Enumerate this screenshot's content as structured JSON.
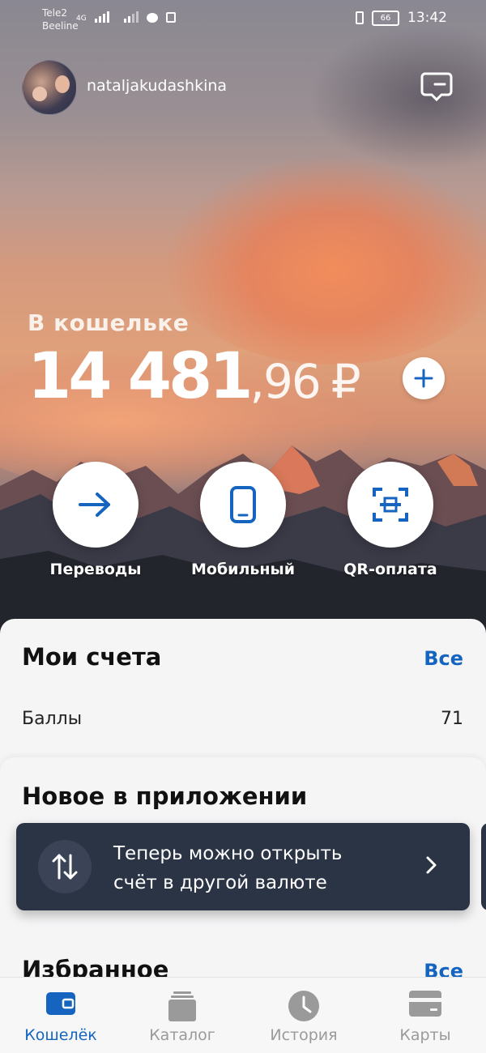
{
  "status_bar": {
    "carrier1": "Tele2",
    "carrier2": "Beeline",
    "network": "4G",
    "battery": "66",
    "time": "13:42"
  },
  "header": {
    "username": "nataljakudashkina",
    "avatar_icon": "avatar",
    "support_icon": "chat-bubble-icon"
  },
  "wallet": {
    "label": "В кошельке",
    "balance_int": "14 481",
    "balance_frac": ",96",
    "currency": "₽",
    "add_icon": "plus-icon"
  },
  "actions": [
    {
      "label": "Переводы",
      "icon": "arrow-right-icon"
    },
    {
      "label": "Мобильный",
      "icon": "phone-icon"
    },
    {
      "label": "QR-оплата",
      "icon": "qr-scan-icon"
    }
  ],
  "accounts": {
    "title": "Мои счета",
    "all_link": "Все",
    "rows": [
      {
        "label": "Баллы",
        "value": "71"
      }
    ]
  },
  "news": {
    "title": "Новое в приложении",
    "promo_line1": "Теперь можно открыть",
    "promo_line2": "счёт в другой валюте"
  },
  "favorites": {
    "title": "Избранное",
    "all_link": "Все"
  },
  "tabs": [
    {
      "label": "Кошелёк",
      "icon": "wallet-icon",
      "active": true
    },
    {
      "label": "Каталог",
      "icon": "catalog-icon",
      "active": false
    },
    {
      "label": "История",
      "icon": "clock-icon",
      "active": false
    },
    {
      "label": "Карты",
      "icon": "card-icon",
      "active": false
    }
  ],
  "colors": {
    "accent": "#1565c0",
    "promo_bg": "#2b3445",
    "sheet_bg": "#f5f5f6"
  }
}
